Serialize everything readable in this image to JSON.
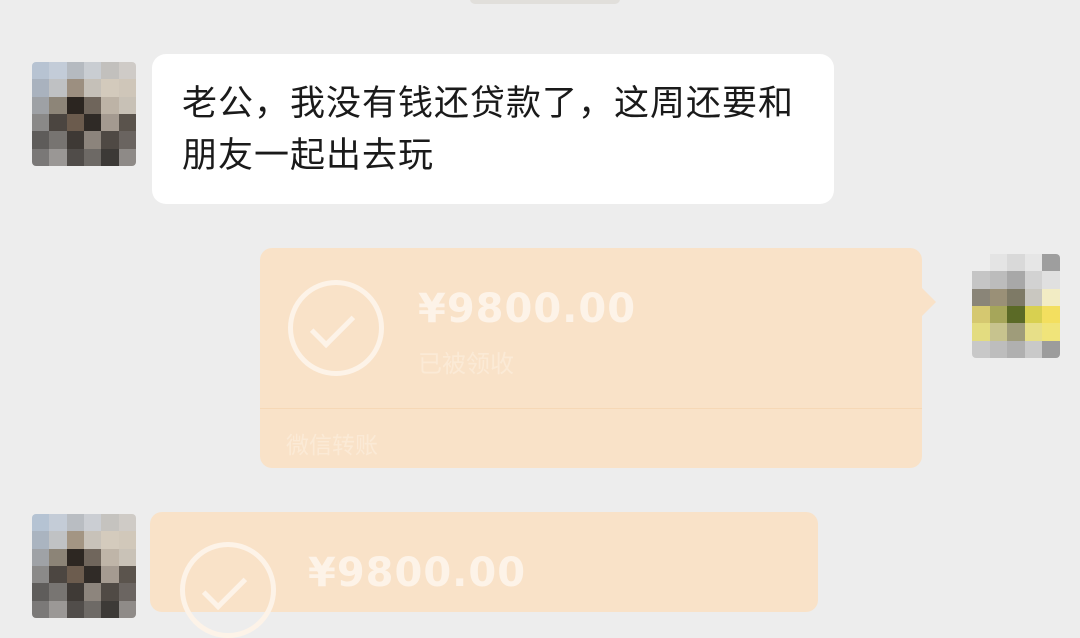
{
  "messages": {
    "incoming_text": "老公，我没有钱还贷款了，这周还要和朋友一起出去玩",
    "outgoing_transfer": {
      "amount": "¥9800.00",
      "status": "已被领收",
      "source": "微信转账"
    },
    "incoming_transfer": {
      "amount": "¥9800.00"
    }
  },
  "colors": {
    "chat_background": "#ededed",
    "text_bubble": "#ffffff",
    "transfer_card": "#f9e2c8"
  },
  "icons": {
    "transfer_status": "check-circle-icon"
  }
}
